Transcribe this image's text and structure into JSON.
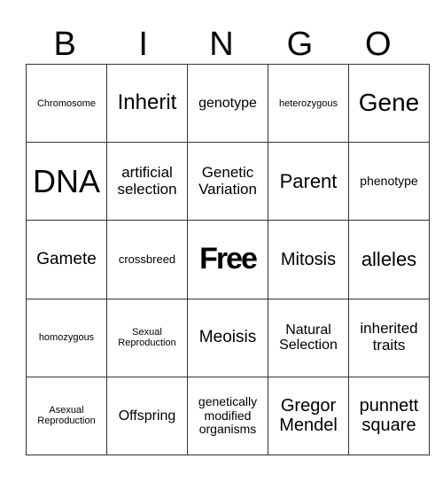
{
  "header": [
    "B",
    "I",
    "N",
    "G",
    "O"
  ],
  "rows": [
    [
      "Chromosome",
      "Inherit",
      "genotype",
      "heterozygous",
      "Gene"
    ],
    [
      "DNA",
      "artificial selection",
      "Genetic Variation",
      "Parent",
      "phenotype"
    ],
    [
      "Gamete",
      "crossbreed",
      "Free",
      "Mitosis",
      "alleles"
    ],
    [
      "homozygous",
      "Sexual Reproduction",
      "Meoisis",
      "Natural Selection",
      "inherited traits"
    ],
    [
      "Asexual Reproduction",
      "Offspring",
      "genetically modified organisms",
      "Gregor Mendel",
      "punnett square"
    ]
  ]
}
